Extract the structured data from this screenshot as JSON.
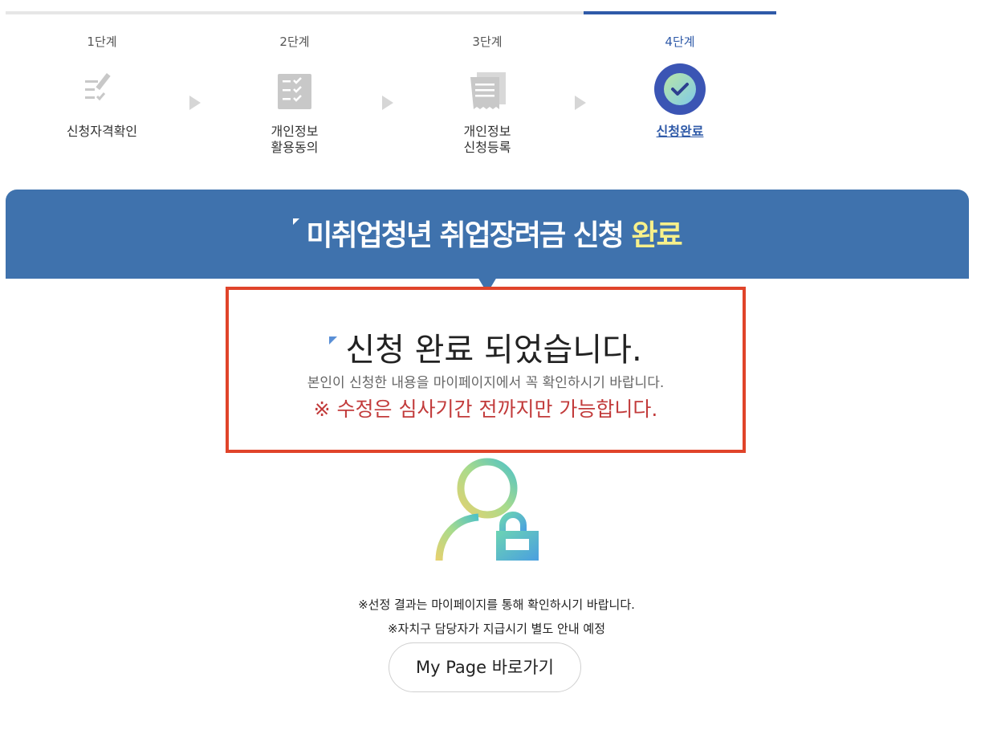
{
  "steps": [
    {
      "num": "1단계",
      "label": "신청자격확인",
      "icon": "checklist-pen-icon"
    },
    {
      "num": "2단계",
      "label": "개인정보\n활용동의",
      "icon": "consent-document-icon"
    },
    {
      "num": "3단계",
      "label": "개인정보\n신청등록",
      "icon": "registration-receipt-icon"
    },
    {
      "num": "4단계",
      "label": "신청완료",
      "icon": "check-circle-icon"
    }
  ],
  "current_step": 4,
  "banner": {
    "title_main": "미취업청년 취업장려금 신청",
    "title_accent": "완료"
  },
  "result": {
    "title": "신청 완료 되었습니다.",
    "subtitle": "본인이 신청한 내용을 마이페이지에서 꼭 확인하시기 바랍니다.",
    "warning": "※ 수정은 심사기간 전까지만 가능합니다."
  },
  "notes": {
    "line1": "※선정 결과는 마이페이지를 통해 확인하시기 바랍니다.",
    "line2": "※자치구 담당자가 지급시기 별도 안내 예정"
  },
  "mypage_button": "My Page 바로가기",
  "colors": {
    "primary": "#3f72ad",
    "accent_yellow": "#f7f08a",
    "warning_red": "#c23b3b",
    "box_border": "#e0442a"
  }
}
